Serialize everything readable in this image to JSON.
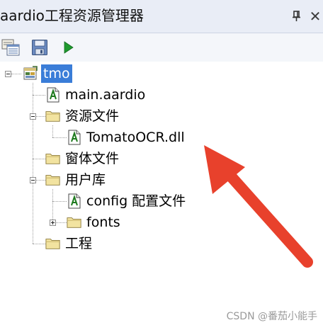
{
  "window": {
    "title": "aardio工程资源管理器",
    "pin_glyph": "❙",
    "close_glyph": "✕"
  },
  "toolbar": {
    "buttons": [
      {
        "icon": "properties-icon"
      },
      {
        "icon": "save-icon"
      },
      {
        "icon": "run-icon"
      }
    ]
  },
  "tree": {
    "root": {
      "label": "tmo",
      "icon": "project-icon",
      "expanded": true,
      "selected": true
    },
    "items": [
      {
        "label": "main.aardio",
        "icon": "aardio-file-icon"
      },
      {
        "label": "资源文件",
        "icon": "folder-icon",
        "expanded": true
      },
      {
        "label": "TomatoOCR.dll",
        "icon": "aardio-file-icon"
      },
      {
        "label": "窗体文件",
        "icon": "folder-icon"
      },
      {
        "label": "用户库",
        "icon": "folder-icon",
        "expanded": true
      },
      {
        "label": "config 配置文件",
        "icon": "aardio-file-icon"
      },
      {
        "label": "fonts",
        "icon": "folder-icon",
        "expanded": false
      },
      {
        "label": "工程",
        "icon": "folder-icon"
      }
    ]
  },
  "watermark": "CSDN @番茄小能手",
  "colors": {
    "selection": "#3a7dd8",
    "arrow": "#e8412c",
    "titlebar": "#e9edf6"
  }
}
